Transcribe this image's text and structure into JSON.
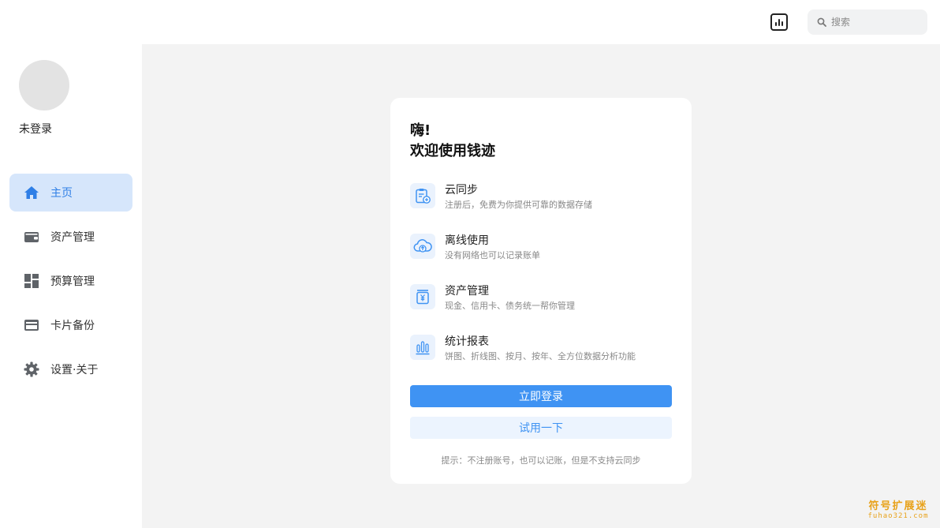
{
  "header": {
    "stats_icon": "bar-chart-icon",
    "search": {
      "placeholder": "搜索",
      "value": "",
      "icon": "search-icon"
    }
  },
  "sidebar": {
    "username": "未登录",
    "items": [
      {
        "label": "主页",
        "icon": "home-icon",
        "active": true
      },
      {
        "label": "资产管理",
        "icon": "wallet-icon",
        "active": false
      },
      {
        "label": "预算管理",
        "icon": "dashboard-icon",
        "active": false
      },
      {
        "label": "卡片备份",
        "icon": "card-icon",
        "active": false
      },
      {
        "label": "设置·关于",
        "icon": "gear-icon",
        "active": false
      }
    ]
  },
  "card": {
    "greeting": "嗨!",
    "welcome": "欢迎使用钱迹",
    "features": [
      {
        "title": "云同步",
        "desc": "注册后，免费为你提供可靠的数据存储",
        "icon": "clipboard-sync-icon"
      },
      {
        "title": "离线使用",
        "desc": "没有网络也可以记录账单",
        "icon": "cloud-upload-icon"
      },
      {
        "title": "资产管理",
        "desc": "现金、信用卡、债务统一帮你管理",
        "icon": "yen-jar-icon"
      },
      {
        "title": "统计报表",
        "desc": "饼图、折线图、按月、按年、全方位数据分析功能",
        "icon": "bar-chart-icon"
      }
    ],
    "login_label": "立即登录",
    "trial_label": "试用一下",
    "hint": "提示：不注册账号，也可以记账，但是不支持云同步"
  },
  "watermark": {
    "line1": "符号扩展迷",
    "line2": "fuhao321.com"
  },
  "colors": {
    "accent": "#3f93f3",
    "active_bg": "#d6e6fb",
    "main_bg": "#f3f3f3",
    "icon_bg": "#eaf2fd"
  }
}
